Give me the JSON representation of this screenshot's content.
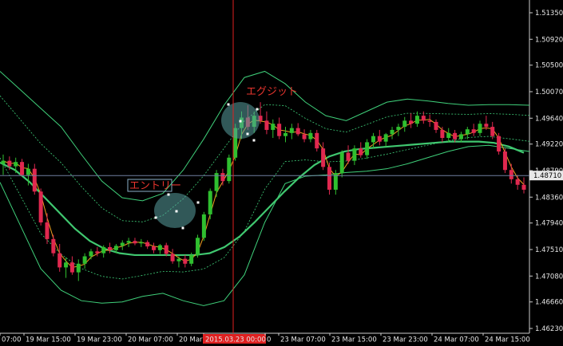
{
  "chart_data": {
    "type": "candlestick",
    "colors": {
      "background": "#000000",
      "bull": "#2fbf2f",
      "bear": "#e0284f",
      "bollinger": "#3fd07a",
      "bollinger_inner": "#3fd07a",
      "moving_average_slow": "#40c870",
      "moving_average_fast": "#f0a020",
      "crosshair": "#e02020",
      "hline": "#6f7fa0",
      "price_tag": "#e8e8e8",
      "date_tag": "#e02020",
      "ellipse": "#5aa0a0"
    },
    "y_ticks": [
      "1.51350",
      "1.50920",
      "1.50500",
      "1.50070",
      "1.49640",
      "1.49220",
      "1.48790",
      "1.48360",
      "1.47940",
      "1.47510",
      "1.47080",
      "1.46660",
      "1.46230"
    ],
    "current_price_label": "1.48710",
    "current_price": 1.4871,
    "ylim": [
      1.4623,
      1.5155
    ],
    "x_ticks": [
      "07:00",
      "19 Mar 15:00",
      "19 Mar 23:00",
      "20 Mar 07:00",
      "20 Mar",
      "2015.03.23 00:00",
      "0",
      "23 Mar 07:00",
      "23 Mar 15:00",
      "23 Mar 23:00",
      "24 Mar 07:00",
      "24 Mar 15:00"
    ],
    "crosshair_time_label": "2015.03.23 00:00",
    "annotations": {
      "entry": "エントリー",
      "exit": "エグジット"
    },
    "candles": [
      [
        1.489,
        1.4905,
        1.4872,
        1.4895
      ],
      [
        1.4895,
        1.4902,
        1.488,
        1.4886
      ],
      [
        1.4886,
        1.49,
        1.4875,
        1.4893
      ],
      [
        1.4893,
        1.4898,
        1.487,
        1.4872
      ],
      [
        1.4872,
        1.489,
        1.4855,
        1.4882
      ],
      [
        1.4882,
        1.489,
        1.484,
        1.4845
      ],
      [
        1.4845,
        1.485,
        1.479,
        1.4795
      ],
      [
        1.4795,
        1.481,
        1.476,
        1.4768
      ],
      [
        1.4768,
        1.4775,
        1.474,
        1.4745
      ],
      [
        1.4745,
        1.476,
        1.4715,
        1.4722
      ],
      [
        1.4722,
        1.4738,
        1.4705,
        1.473
      ],
      [
        1.473,
        1.474,
        1.471,
        1.4714
      ],
      [
        1.4714,
        1.4735,
        1.47,
        1.4728
      ],
      [
        1.4728,
        1.4745,
        1.472,
        1.474
      ],
      [
        1.474,
        1.4752,
        1.4735,
        1.4748
      ],
      [
        1.4748,
        1.4755,
        1.474,
        1.4745
      ],
      [
        1.4745,
        1.4758,
        1.4738,
        1.4755
      ],
      [
        1.4755,
        1.4762,
        1.4745,
        1.475
      ],
      [
        1.475,
        1.476,
        1.4745,
        1.4757
      ],
      [
        1.4757,
        1.4766,
        1.475,
        1.4762
      ],
      [
        1.4762,
        1.477,
        1.4755,
        1.4765
      ],
      [
        1.4765,
        1.477,
        1.4758,
        1.4761
      ],
      [
        1.4761,
        1.4768,
        1.4755,
        1.4763
      ],
      [
        1.4763,
        1.4766,
        1.4752,
        1.4756
      ],
      [
        1.4756,
        1.4762,
        1.4745,
        1.475
      ],
      [
        1.475,
        1.476,
        1.4744,
        1.4758
      ],
      [
        1.4758,
        1.4762,
        1.474,
        1.4744
      ],
      [
        1.4744,
        1.4752,
        1.4728,
        1.4732
      ],
      [
        1.4732,
        1.474,
        1.4722,
        1.4736
      ],
      [
        1.4736,
        1.4742,
        1.4722,
        1.4728
      ],
      [
        1.4728,
        1.4746,
        1.4724,
        1.4742
      ],
      [
        1.4742,
        1.4775,
        1.4738,
        1.477
      ],
      [
        1.477,
        1.4812,
        1.4765,
        1.4808
      ],
      [
        1.4808,
        1.485,
        1.48,
        1.4846
      ],
      [
        1.4846,
        1.488,
        1.4836,
        1.4875
      ],
      [
        1.4875,
        1.4882,
        1.4855,
        1.4862
      ],
      [
        1.4862,
        1.4905,
        1.4858,
        1.49
      ],
      [
        1.49,
        1.4955,
        1.4895,
        1.4948
      ],
      [
        1.4948,
        1.4975,
        1.493,
        1.4965
      ],
      [
        1.4965,
        1.4985,
        1.4945,
        1.495
      ],
      [
        1.495,
        1.4975,
        1.494,
        1.4968
      ],
      [
        1.4968,
        1.499,
        1.4955,
        1.496
      ],
      [
        1.496,
        1.4975,
        1.4938,
        1.4945
      ],
      [
        1.4945,
        1.4962,
        1.4932,
        1.4955
      ],
      [
        1.4955,
        1.4965,
        1.493,
        1.4935
      ],
      [
        1.4935,
        1.495,
        1.4925,
        1.494
      ],
      [
        1.494,
        1.4955,
        1.493,
        1.4948
      ],
      [
        1.4948,
        1.4956,
        1.4935,
        1.4938
      ],
      [
        1.4938,
        1.4946,
        1.4925,
        1.493
      ],
      [
        1.493,
        1.4945,
        1.4925,
        1.494
      ],
      [
        1.494,
        1.4945,
        1.491,
        1.4915
      ],
      [
        1.4915,
        1.4925,
        1.488,
        1.4885
      ],
      [
        1.4885,
        1.4892,
        1.484,
        1.4848
      ],
      [
        1.4848,
        1.488,
        1.484,
        1.4875
      ],
      [
        1.4875,
        1.4912,
        1.4868,
        1.4908
      ],
      [
        1.4908,
        1.492,
        1.489,
        1.4895
      ],
      [
        1.4895,
        1.492,
        1.4888,
        1.4915
      ],
      [
        1.4915,
        1.4925,
        1.49,
        1.4904
      ],
      [
        1.4904,
        1.493,
        1.4898,
        1.4925
      ],
      [
        1.4925,
        1.494,
        1.4915,
        1.4935
      ],
      [
        1.4935,
        1.4945,
        1.492,
        1.4926
      ],
      [
        1.4926,
        1.494,
        1.4918,
        1.4938
      ],
      [
        1.4938,
        1.495,
        1.493,
        1.4945
      ],
      [
        1.4945,
        1.4955,
        1.4935,
        1.495
      ],
      [
        1.495,
        1.4966,
        1.4942,
        1.496
      ],
      [
        1.496,
        1.4972,
        1.4948,
        1.4955
      ],
      [
        1.4955,
        1.4975,
        1.495,
        1.4968
      ],
      [
        1.4968,
        1.4975,
        1.4955,
        1.496
      ],
      [
        1.496,
        1.497,
        1.495,
        1.4958
      ],
      [
        1.4958,
        1.4962,
        1.494,
        1.4945
      ],
      [
        1.4945,
        1.495,
        1.4925,
        1.4932
      ],
      [
        1.4932,
        1.4948,
        1.4925,
        1.494
      ],
      [
        1.494,
        1.4945,
        1.4925,
        1.493
      ],
      [
        1.493,
        1.4942,
        1.4925,
        1.4938
      ],
      [
        1.4938,
        1.495,
        1.493,
        1.4946
      ],
      [
        1.4946,
        1.4955,
        1.4935,
        1.494
      ],
      [
        1.494,
        1.496,
        1.4935,
        1.4955
      ],
      [
        1.4955,
        1.4968,
        1.4945,
        1.495
      ],
      [
        1.495,
        1.4958,
        1.493,
        1.4935
      ],
      [
        1.4935,
        1.494,
        1.4905,
        1.491
      ],
      [
        1.491,
        1.4915,
        1.4875,
        1.488
      ],
      [
        1.488,
        1.489,
        1.4858,
        1.4865
      ],
      [
        1.4865,
        1.4872,
        1.4848,
        1.4856
      ],
      [
        1.4856,
        1.4868,
        1.4842,
        1.4848
      ]
    ],
    "ma_slow": [
      1.4892,
      1.488,
      1.486,
      1.4835,
      1.481,
      1.4785,
      1.4765,
      1.4752,
      1.4745,
      1.4742,
      1.4742,
      1.4742,
      1.4742,
      1.4742,
      1.4745,
      1.4755,
      1.4772,
      1.4795,
      1.482,
      1.4845,
      1.4868,
      1.4888,
      1.4902,
      1.491,
      1.4914,
      1.4916,
      1.4918,
      1.492,
      1.4922,
      1.4924,
      1.4926,
      1.4926,
      1.4926,
      1.4924,
      1.4918,
      1.4908
    ],
    "ma_slow_from": 0,
    "ma_slow_step": 2.4,
    "ma_fast_lag": 2,
    "bb_upper": [
      1.504,
      1.501,
      1.498,
      1.495,
      1.4905,
      1.4862,
      1.4835,
      1.483,
      1.4842,
      1.488,
      1.493,
      1.4985,
      1.503,
      1.504,
      1.502,
      1.499,
      1.4968,
      1.496,
      1.4975,
      1.499,
      1.4995,
      1.4992,
      1.4988,
      1.4985,
      1.4986,
      1.4986,
      1.4985
    ],
    "bb_lower": [
      1.486,
      1.479,
      1.472,
      1.4685,
      1.4668,
      1.4664,
      1.4666,
      1.4675,
      1.468,
      1.4668,
      1.466,
      1.4668,
      1.471,
      1.4795,
      1.4858,
      1.487,
      1.4872,
      1.4876,
      1.4878,
      1.4882,
      1.489,
      1.49,
      1.491,
      1.4918,
      1.492,
      1.4915,
      1.491
    ],
    "bb_step": 3.3
  }
}
